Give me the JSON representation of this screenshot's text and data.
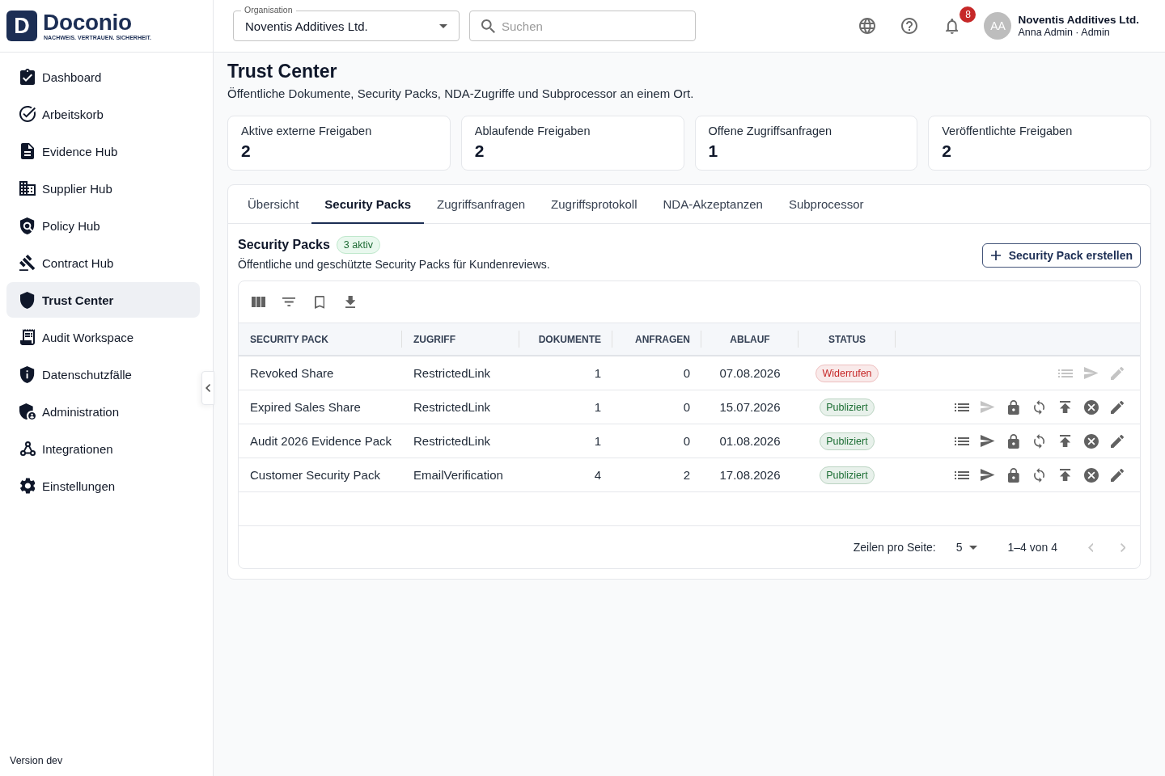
{
  "logo": {
    "mark": "D",
    "name": "Doconio",
    "tagline": "NACHWEIS. VERTRAUEN. SICHERHEIT."
  },
  "sidebar": {
    "items": [
      {
        "label": "Dashboard",
        "selected": false
      },
      {
        "label": "Arbeitskorb",
        "selected": false
      },
      {
        "label": "Evidence Hub",
        "selected": false
      },
      {
        "label": "Supplier Hub",
        "selected": false
      },
      {
        "label": "Policy Hub",
        "selected": false
      },
      {
        "label": "Contract Hub",
        "selected": false
      },
      {
        "label": "Trust Center",
        "selected": true
      },
      {
        "label": "Audit Workspace",
        "selected": false
      },
      {
        "label": "Datenschutzfälle",
        "selected": false
      },
      {
        "label": "Administration",
        "selected": false
      },
      {
        "label": "Integrationen",
        "selected": false
      },
      {
        "label": "Einstellungen",
        "selected": false
      }
    ],
    "version": "Version dev"
  },
  "header": {
    "organisation_select": {
      "label": "Organisation",
      "value": "Noventis Additives Ltd."
    },
    "search": {
      "placeholder": "Suchen"
    },
    "notifications": {
      "count": "8"
    },
    "user": {
      "initials": "AA",
      "organisation": "Noventis Additives Ltd.",
      "name": "Anna Admin · Admin"
    }
  },
  "page": {
    "title": "Trust Center",
    "subtitle": "Öffentliche Dokumente, Security Packs, NDA-Zugriffe und Subprocessor an einem Ort."
  },
  "stats": [
    {
      "label": "Aktive externe Freigaben",
      "value": "2"
    },
    {
      "label": "Ablaufende Freigaben",
      "value": "2"
    },
    {
      "label": "Offene Zugriffsanfragen",
      "value": "1"
    },
    {
      "label": "Veröffentlichte Freigaben",
      "value": "2"
    }
  ],
  "tabs": [
    {
      "label": "Übersicht",
      "selected": false
    },
    {
      "label": "Security Packs",
      "selected": true
    },
    {
      "label": "Zugriffsanfragen",
      "selected": false
    },
    {
      "label": "Zugriffsprotokoll",
      "selected": false
    },
    {
      "label": "NDA-Akzeptanzen",
      "selected": false
    },
    {
      "label": "Subprocessor",
      "selected": false
    }
  ],
  "section": {
    "title": "Security Packs",
    "badge": "3 aktiv",
    "description": "Öffentliche und geschützte Security Packs für Kundenreviews.",
    "create_button": "Security Pack erstellen"
  },
  "table": {
    "columns": [
      "SECURITY PACK",
      "ZUGRIFF",
      "DOKUMENTE",
      "ANFRAGEN",
      "ABLAUF",
      "STATUS"
    ],
    "rows": [
      {
        "name": "Revoked Share",
        "access": "RestrictedLink",
        "documents": "1",
        "requests": "0",
        "expiry": "07.08.2026",
        "status": {
          "label": "Widerrufen",
          "color": "#c62828"
        },
        "actions": [
          {
            "kind": "list",
            "disabled": true
          },
          {
            "kind": "send",
            "disabled": true
          },
          {
            "kind": "edit",
            "disabled": true
          }
        ]
      },
      {
        "name": "Expired Sales Share",
        "access": "RestrictedLink",
        "documents": "1",
        "requests": "0",
        "expiry": "15.07.2026",
        "status": {
          "label": "Publiziert",
          "color": "#1b6e33"
        },
        "actions": [
          {
            "kind": "list",
            "disabled": false
          },
          {
            "kind": "send",
            "disabled": true
          },
          {
            "kind": "lock",
            "disabled": false
          },
          {
            "kind": "sync",
            "disabled": false
          },
          {
            "kind": "publish",
            "disabled": false
          },
          {
            "kind": "revoke",
            "disabled": false
          },
          {
            "kind": "edit",
            "disabled": false
          }
        ]
      },
      {
        "name": "Audit 2026 Evidence Pack",
        "access": "RestrictedLink",
        "documents": "1",
        "requests": "0",
        "expiry": "01.08.2026",
        "status": {
          "label": "Publiziert",
          "color": "#1b6e33"
        },
        "actions": [
          {
            "kind": "list",
            "disabled": false
          },
          {
            "kind": "send",
            "disabled": false
          },
          {
            "kind": "lock",
            "disabled": false
          },
          {
            "kind": "sync",
            "disabled": false
          },
          {
            "kind": "publish",
            "disabled": false
          },
          {
            "kind": "revoke",
            "disabled": false
          },
          {
            "kind": "edit",
            "disabled": false
          }
        ]
      },
      {
        "name": "Customer Security Pack",
        "access": "EmailVerification",
        "documents": "4",
        "requests": "2",
        "expiry": "17.08.2026",
        "status": {
          "label": "Publiziert",
          "color": "#1b6e33"
        },
        "actions": [
          {
            "kind": "list",
            "disabled": false
          },
          {
            "kind": "send",
            "disabled": false
          },
          {
            "kind": "lock",
            "disabled": false
          },
          {
            "kind": "sync",
            "disabled": false
          },
          {
            "kind": "publish",
            "disabled": false
          },
          {
            "kind": "revoke",
            "disabled": false
          },
          {
            "kind": "edit",
            "disabled": false
          }
        ]
      }
    ],
    "pagination": {
      "rows_per_page_label": "Zeilen pro Seite:",
      "rows_per_page": "5",
      "range": "1–4 von 4",
      "previous": {
        "disabled": true
      },
      "next": {
        "disabled": true
      }
    }
  }
}
